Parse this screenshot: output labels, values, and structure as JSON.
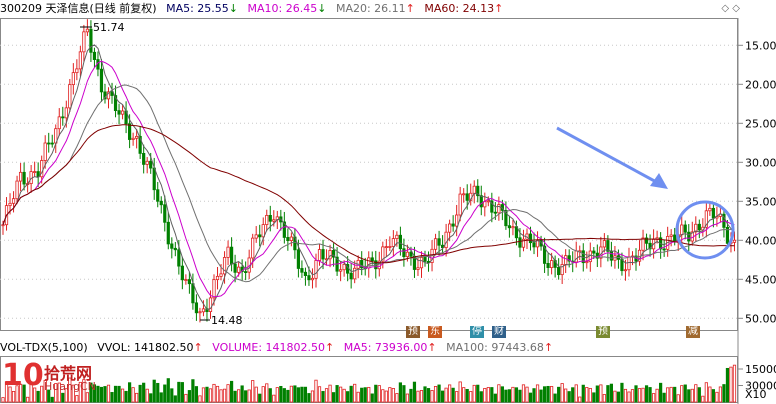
{
  "header": {
    "code_name": "300209 天泽信息(日线 前复权)",
    "ma5": "MA5: 25.55",
    "ma10": "MA10: 26.45",
    "ma20": "MA20: 26.11",
    "ma60": "MA60: 24.13"
  },
  "volume_header": {
    "vol_tdx": "VOL-TDX(5,100)",
    "vvol": "VVOL: 141802.50",
    "volume": "VOLUME: 141802.50",
    "ma5": "MA5: 73936.00",
    "ma100": "MA100: 97443.68"
  },
  "annotations": {
    "high": "51.74",
    "low": "14.48"
  },
  "badges": [
    {
      "text": "预",
      "color": "#8b5a2b"
    },
    {
      "text": "东",
      "color": "#c85a20"
    },
    {
      "text": "停",
      "color": "#2f8fa8"
    },
    {
      "text": "财",
      "color": "#30608a"
    },
    {
      "text": "预",
      "color": "#7a8a30"
    },
    {
      "text": "减",
      "color": "#a06a30"
    }
  ],
  "price_axis": [
    "50.00",
    "45.00",
    "40.00",
    "35.00",
    "30.00",
    "25.00",
    "20.00",
    "15.00"
  ],
  "volume_axis": [
    "30000",
    "15000",
    "X10"
  ],
  "logo": {
    "ten": "10",
    "cn": "拾荒网",
    "url": "HuangCN"
  },
  "colors": {
    "up": "#e02020",
    "down": "#008000",
    "ma5": "#606060",
    "ma10": "#cc00cc",
    "ma20": "#707070",
    "ma60": "#800000",
    "arrow": "#6f8ff0"
  },
  "chart_data": {
    "type": "candlestick",
    "ylim": [
      13.5,
      53.5
    ],
    "y_ticks": [
      15,
      20,
      25,
      30,
      35,
      40,
      45,
      50
    ],
    "high_marker": 51.74,
    "low_marker": 14.48,
    "anchors": [
      [
        0,
        27
      ],
      [
        5,
        33
      ],
      [
        10,
        34
      ],
      [
        15,
        39
      ],
      [
        20,
        46
      ],
      [
        24,
        51.7
      ],
      [
        28,
        45
      ],
      [
        33,
        41
      ],
      [
        38,
        38
      ],
      [
        42,
        33
      ],
      [
        47,
        26
      ],
      [
        52,
        19
      ],
      [
        56,
        15.5
      ],
      [
        60,
        19
      ],
      [
        64,
        23
      ],
      [
        68,
        21
      ],
      [
        72,
        25
      ],
      [
        77,
        29
      ],
      [
        82,
        24
      ],
      [
        86,
        20
      ],
      [
        90,
        23
      ],
      [
        95,
        22
      ],
      [
        100,
        21
      ],
      [
        105,
        22
      ],
      [
        110,
        25
      ],
      [
        115,
        23
      ],
      [
        120,
        22
      ],
      [
        125,
        25
      ],
      [
        130,
        30
      ],
      [
        135,
        31
      ],
      [
        140,
        29
      ],
      [
        145,
        26
      ],
      [
        150,
        25
      ],
      [
        155,
        22
      ],
      [
        160,
        22
      ],
      [
        165,
        23
      ],
      [
        170,
        24
      ],
      [
        175,
        22
      ],
      [
        180,
        23
      ],
      [
        185,
        25
      ],
      [
        190,
        25
      ],
      [
        195,
        26
      ],
      [
        200,
        28
      ],
      [
        203,
        28
      ],
      [
        206,
        26
      ],
      [
        208,
        24.6
      ]
    ],
    "volume_ylim": [
      0,
      40000
    ],
    "volume_ticks": [
      15000,
      30000
    ]
  }
}
